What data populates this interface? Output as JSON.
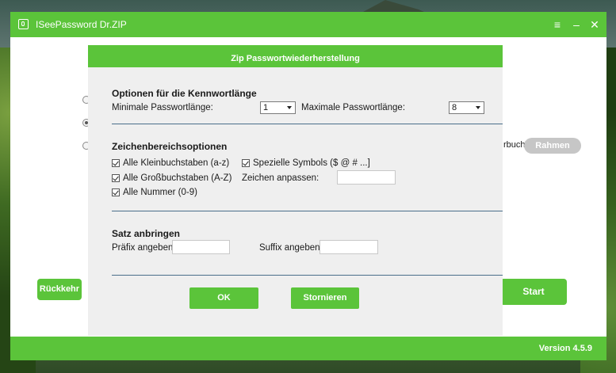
{
  "app": {
    "title": "ISeePassword Dr.ZIP",
    "version": "Version 4.5.9"
  },
  "window_controls": {
    "menu": "≡",
    "minimize": "–",
    "close": "✕"
  },
  "background_text": {
    "partial_label": "rbuch)",
    "frame_button": "Rahmen"
  },
  "buttons": {
    "back": "Rückkehr",
    "start": "Start"
  },
  "dialog": {
    "title": "Zip Passwortwiederherstellung",
    "length_section": {
      "title": "Optionen für die Kennwortlänge",
      "min_label": "Minimale Passwortlänge:",
      "min_value": "1",
      "max_label": "Maximale Passwortlänge:",
      "max_value": "8"
    },
    "charset_section": {
      "title": "Zeichenbereichsoptionen",
      "options": [
        {
          "label": "Alle Kleinbuchstaben (a-z)",
          "checked": true
        },
        {
          "label": "Alle Großbuchstaben (A-Z)",
          "checked": true
        },
        {
          "label": "Alle Nummer (0-9)",
          "checked": true
        },
        {
          "label": "Spezielle Symbols ($ @ # ...]",
          "checked": true
        }
      ],
      "custom_label": "Zeichen anpassen:",
      "custom_value": ""
    },
    "affix_section": {
      "title": "Satz anbringen",
      "prefix_label": "Präfix angeben:",
      "prefix_value": "",
      "suffix_label": "Suffix angeben:",
      "suffix_value": ""
    },
    "ok_label": "OK",
    "cancel_label": "Stornieren"
  },
  "colors": {
    "accent": "#5bc43a",
    "dialog_bg": "#efefef",
    "divider": "#4a6e8a",
    "disabled": "#c6c6c6"
  }
}
